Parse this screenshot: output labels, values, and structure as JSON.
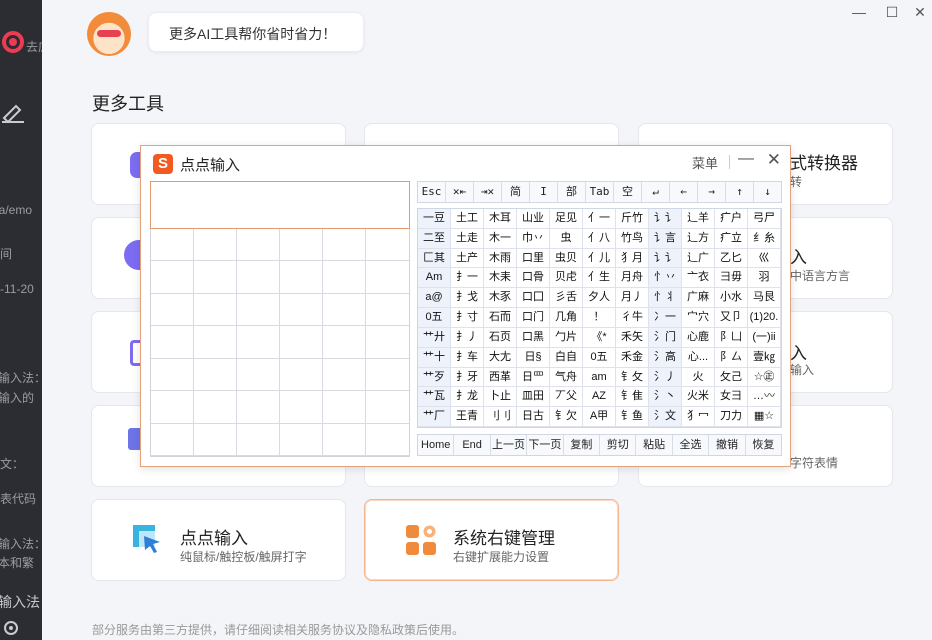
{
  "sidebar": {
    "fragments": [
      "去広",
      "ia/emo",
      "间",
      "-11-20",
      "输入法：",
      "输入的",
      "文：",
      "表代码",
      "输入法：",
      "本和繁",
      "输入法"
    ]
  },
  "header": {
    "bubble_text": "更多AI工具帮你省时省力！",
    "window_controls": {
      "minimize": "—",
      "maximize": "☐",
      "close": "✕"
    }
  },
  "main": {
    "section_title": "更多工具",
    "cards": [
      {
        "title": "",
        "subtitle": ""
      },
      {
        "title": "",
        "subtitle": ""
      },
      {
        "title": "式转换器",
        "subtitle": "转"
      },
      {
        "title": "",
        "subtitle": ""
      },
      {
        "title": "入",
        "subtitle": "中语言方言"
      },
      {
        "title": "",
        "subtitle": ""
      },
      {
        "title": "入",
        "subtitle": "输入"
      },
      {
        "title": "",
        "subtitle": ""
      },
      {
        "title": "",
        "subtitle": "字符表情"
      },
      {
        "title": "点点输入",
        "subtitle": "纯鼠标/触控板/触屏打字"
      },
      {
        "title": "系统右键管理",
        "subtitle": "右键扩展能力设置"
      }
    ],
    "footer_note": "部分服务由第三方提供，请仔细阅读相关服务协议及隐私政策后使用。"
  },
  "ime": {
    "logo": "S",
    "title": "点点输入",
    "menu": "菜单",
    "minimize": "—",
    "close": "✕",
    "keybar": [
      "Esc",
      "✕⇤",
      "⇥✕",
      "简",
      "I",
      "部",
      "Tab",
      "空",
      "↵",
      "←",
      "→",
      "↑",
      "↓"
    ],
    "symbols": [
      [
        "一豆",
        "土工",
        "木耳",
        "山业",
        "足见",
        "亻一",
        "斤竹",
        "讠讠",
        "辶羊",
        "疒户",
        "弓尸"
      ],
      [
        "二至",
        "土走",
        "木一",
        "巾丷",
        "虫",
        "亻八",
        "竹鸟",
        "讠言",
        "辶方",
        "疒立",
        "纟糸"
      ],
      [
        "匚其",
        "土产",
        "木雨",
        "口里",
        "虫贝",
        "亻儿",
        "犭月",
        "讠讠",
        "辶广",
        "乙匕",
        "巛"
      ],
      [
        "Am",
        "扌一",
        "木耒",
        "口骨",
        "贝虍",
        "亻生",
        "月舟",
        "忄丷",
        "亠衣",
        "彐毋",
        "羽"
      ],
      [
        "a@",
        "扌戈",
        "木豕",
        "口囗",
        "彡舌",
        "夕人",
        "月丿",
        "忄丬",
        "广麻",
        "小水",
        "马艮"
      ],
      [
        "0五",
        "扌寸",
        "石而",
        "口门",
        "几角",
        "！",
        "彳牛",
        "冫一",
        "宀穴",
        "又卩",
        "(1)20."
      ],
      [
        "艹廾",
        "扌丿",
        "石页",
        "口黑",
        "勹片",
        "《*",
        "禾矢",
        "氵门",
        "心鹿",
        "阝凵",
        "(一)ii"
      ],
      [
        "艹十",
        "扌车",
        "大尢",
        "日§",
        "白自",
        "0五",
        "禾金",
        "氵高",
        "心...",
        "阝厶",
        "壹㎏"
      ],
      [
        "艹歹",
        "扌牙",
        "西革",
        "日罒",
        "气舟",
        "am",
        "钅攵",
        "氵丿",
        "火",
        "攵己",
        "☆㊣"
      ],
      [
        "艹瓦",
        "扌龙",
        "卜止",
        "皿田",
        "丆父",
        "AZ",
        "钅隹",
        "氵丶",
        "火米",
        "女彐",
        "…〰"
      ],
      [
        "艹厂",
        "王青",
        "刂刂",
        "日古",
        "钅欠",
        "A甲",
        "钅鱼",
        "氵文",
        "犭冖",
        "刀力",
        "▦☆"
      ]
    ],
    "bottombar": [
      "Home",
      "End",
      "上一页",
      "下一页",
      "复制",
      "剪切",
      "粘贴",
      "全选",
      "撤销",
      "恢复"
    ]
  }
}
